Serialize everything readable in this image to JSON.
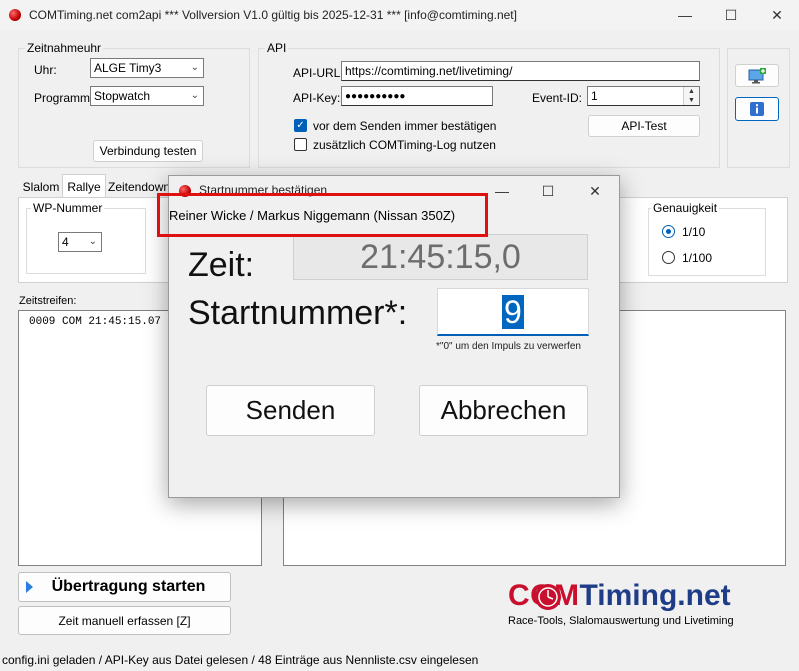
{
  "window": {
    "title": "COMTiming.net com2api *** Vollversion V1.0 gültig bis 2025-12-31 *** [info@comtiming.net]",
    "minimize_glyph": "—",
    "maximize_glyph": "☐",
    "close_glyph": "✕"
  },
  "zeitnahmeuhr": {
    "group_label": "Zeitnahmeuhr",
    "uhr_label": "Uhr:",
    "uhr_value": "ALGE Timy3",
    "programm_label": "Programm:",
    "programm_value": "Stopwatch",
    "test_button": "Verbindung testen"
  },
  "api": {
    "group_label": "API",
    "url_label": "API-URL:",
    "url_value": "https://comtiming.net/livetiming/",
    "key_label": "API-Key:",
    "key_value": "●●●●●●●●●●",
    "event_label": "Event-ID:",
    "event_value": "1",
    "confirm_label": "vor dem Senden immer bestätigen",
    "log_label": "zusätzlich COMTiming-Log nutzen",
    "test_button": "API-Test"
  },
  "tabs": [
    "Slalom",
    "Rallye",
    "Zeitendownl"
  ],
  "wp": {
    "group_label": "WP-Nummer",
    "value": "4"
  },
  "genauigkeit": {
    "group_label": "Genauigkeit",
    "option1": "1/10",
    "option2": "1/100"
  },
  "zeitstreifen": {
    "label": "Zeitstreifen:",
    "rows": [
      "0009 COM 21:45:15.07"
    ]
  },
  "actions": {
    "start_button": "Übertragung starten",
    "manual_button": "Zeit manuell erfassen [Z]"
  },
  "logo": {
    "com": "COM",
    "rest": "Timing.net",
    "tagline": "Race-Tools, Slalomauswertung und Livetiming"
  },
  "status_bar": "config.ini geladen / API-Key aus Datei gelesen / 48 Einträge aus Nennliste.csv eingelesen",
  "dialog": {
    "title": "Startnummer bestätigen",
    "driver": "Reiner Wicke / Markus Niggemann (Nissan 350Z)",
    "zeit_label": "Zeit:",
    "zeit_value": "21:45:15,0",
    "startnummer_label": "Startnummer*:",
    "startnummer_value": "9",
    "hint": "*\"0\" um den Impuls zu verwerfen",
    "send_button": "Senden",
    "cancel_button": "Abbrechen"
  },
  "colors": {
    "accent": "#005fb8",
    "highlight_red": "#e01010",
    "logo_red": "#c8102e",
    "logo_blue": "#1f3c88"
  }
}
